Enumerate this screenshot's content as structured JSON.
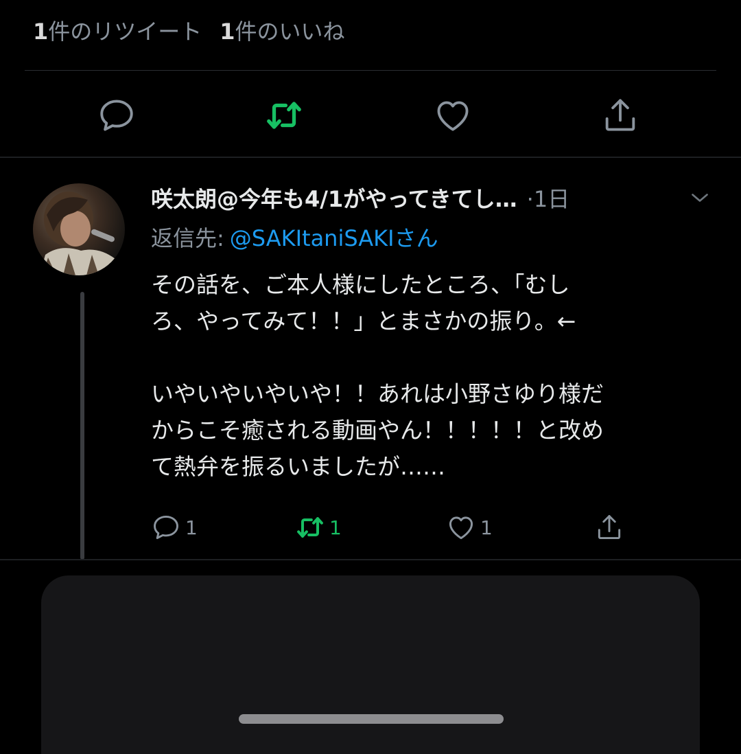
{
  "stats": {
    "retweets_count": "1",
    "retweets_label": "件のリツイート",
    "likes_count": "1",
    "likes_label": "件のいいね"
  },
  "main_actions": [
    {
      "name": "reply",
      "icon": "reply-icon"
    },
    {
      "name": "retweet",
      "icon": "retweet-icon",
      "active": true
    },
    {
      "name": "like",
      "icon": "heart-icon"
    },
    {
      "name": "share",
      "icon": "share-icon"
    }
  ],
  "reply_tweet": {
    "author_name": "咲太朗@今年も4/1がやってきてし…",
    "time": "·1日",
    "reply_to_label": "返信先:",
    "reply_to_handle": "@SAKItaniSAKIさん",
    "body_lines": [
      "その話を、ご本人様にしたところ、「むし",
      "ろ、やってみて！！」とまさかの振り。←",
      "",
      "いやいやいやいや！！あれは小野さゆり様だ",
      "からこそ癒される動画やん！！！！！と改め",
      "て熱弁を振るいましたが……"
    ],
    "actions": {
      "reply_count": "1",
      "retweet_count": "1",
      "like_count": "1"
    }
  },
  "colors": {
    "background": "#000000",
    "text_primary": "#e7e9ea",
    "text_secondary": "#8b949e",
    "link": "#1d9bf0",
    "retweet_active": "#17bf63"
  }
}
